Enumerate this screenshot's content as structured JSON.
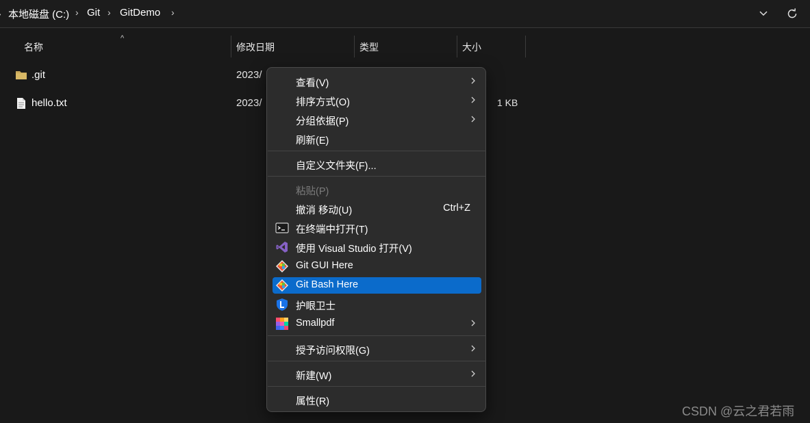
{
  "breadcrumb": {
    "items": [
      "本地磁盘 (C:)",
      "Git",
      "GitDemo"
    ]
  },
  "columns": {
    "name": "名称",
    "modified": "修改日期",
    "type": "类型",
    "size": "大小"
  },
  "files": [
    {
      "name": ".git",
      "modified": "2023/",
      "size": "",
      "icon": "folder-icon"
    },
    {
      "name": "hello.txt",
      "modified": "2023/",
      "size": "1 KB",
      "icon": "text-file-icon"
    }
  ],
  "context_menu": {
    "items": [
      {
        "label": "查看(V)",
        "submenu": true
      },
      {
        "label": "排序方式(O)",
        "submenu": true
      },
      {
        "label": "分组依据(P)",
        "submenu": true
      },
      {
        "label": "刷新(E)"
      },
      {
        "label": "自定义文件夹(F)..."
      },
      {
        "label": "粘贴(P)",
        "disabled": true
      },
      {
        "label": "撤消 移动(U)",
        "shortcut": "Ctrl+Z"
      },
      {
        "label": "在终端中打开(T)",
        "icon": "terminal-icon"
      },
      {
        "label": "使用 Visual Studio 打开(V)",
        "icon": "visual-studio-icon"
      },
      {
        "label": "Git GUI Here",
        "icon": "git-gui-icon"
      },
      {
        "label": "Git Bash Here",
        "icon": "git-bash-icon",
        "highlighted": true
      },
      {
        "label": "护眼卫士",
        "icon": "eye-guard-icon"
      },
      {
        "label": "Smallpdf",
        "icon": "smallpdf-icon",
        "submenu": true
      },
      {
        "label": "授予访问权限(G)",
        "submenu": true
      },
      {
        "label": "新建(W)",
        "submenu": true
      },
      {
        "label": "属性(R)"
      }
    ]
  },
  "colors": {
    "highlight": "#0b6bcb",
    "menu_bg": "#2c2c2c",
    "window_bg": "#191919"
  },
  "watermark": "CSDN @云之君若雨"
}
